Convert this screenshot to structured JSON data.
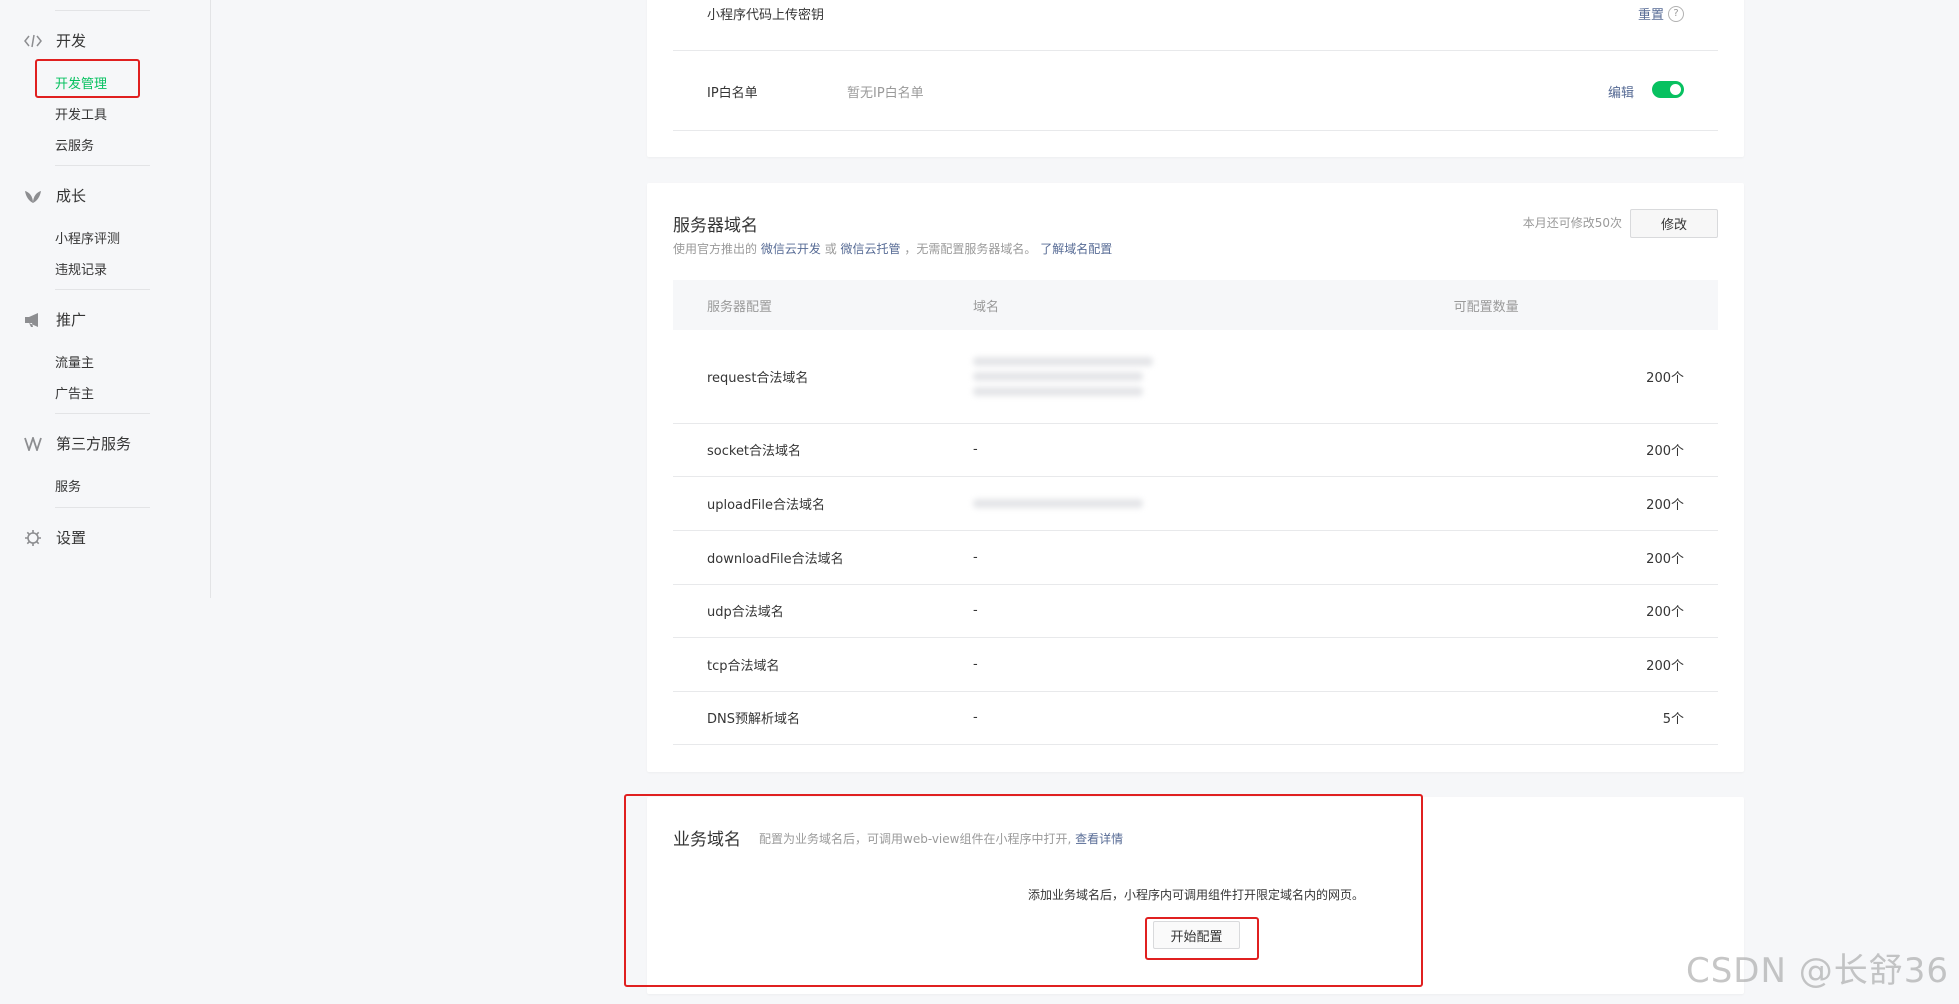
{
  "sidebar": {
    "groups": [
      {
        "label": "开发",
        "icon": "code-icon",
        "items": [
          "开发管理",
          "开发工具",
          "云服务"
        ]
      },
      {
        "label": "成长",
        "icon": "leaf-icon",
        "items": [
          "小程序评测",
          "违规记录"
        ]
      },
      {
        "label": "推广",
        "icon": "megaphone-icon",
        "items": [
          "流量主",
          "广告主"
        ]
      },
      {
        "label": "第三方服务",
        "icon": "third-party-icon",
        "items": [
          "服务"
        ]
      },
      {
        "label": "设置",
        "icon": "gear-icon",
        "items": []
      }
    ],
    "active_item": "开发管理"
  },
  "top_card": {
    "upload_key_label": "小程序代码上传密钥",
    "reset_label": "重置",
    "help_icon": "?",
    "ip_label": "IP白名单",
    "ip_value": "暂无IP白名单",
    "edit_label": "编辑",
    "toggle_on": true
  },
  "server_domain": {
    "title": "服务器域名",
    "desc_prefix": "使用官方推出的",
    "link1": "微信云开发",
    "desc_or": "或",
    "link2": "微信云托管",
    "desc_suffix": "，无需配置服务器域名。",
    "link3": "了解域名配置",
    "remaining": "本月还可修改50次",
    "modify_label": "修改",
    "columns": [
      "服务器配置",
      "域名",
      "可配置数量"
    ],
    "rows": [
      {
        "name": "request合法域名",
        "domain": "",
        "count": "200个",
        "blurred_lines": 3
      },
      {
        "name": "socket合法域名",
        "domain": "-",
        "count": "200个",
        "blurred_lines": 0
      },
      {
        "name": "uploadFile合法域名",
        "domain": "",
        "count": "200个",
        "blurred_lines": 1
      },
      {
        "name": "downloadFile合法域名",
        "domain": "-",
        "count": "200个",
        "blurred_lines": 0
      },
      {
        "name": "udp合法域名",
        "domain": "-",
        "count": "200个",
        "blurred_lines": 0
      },
      {
        "name": "tcp合法域名",
        "domain": "-",
        "count": "200个",
        "blurred_lines": 0
      },
      {
        "name": "DNS预解析域名",
        "domain": "-",
        "count": "5个",
        "blurred_lines": 0
      }
    ]
  },
  "business_domain": {
    "title": "业务域名",
    "desc": "配置为业务域名后，可调用web-view组件在小程序中打开,",
    "detail_link": "查看详情",
    "hint": "添加业务域名后，小程序内可调用组件打开限定域名内的网页。",
    "start_label": "开始配置"
  },
  "watermark": "CSDN @长舒36",
  "colors": {
    "accent": "#07c160",
    "link": "#576b95",
    "highlight": "#e02020"
  }
}
